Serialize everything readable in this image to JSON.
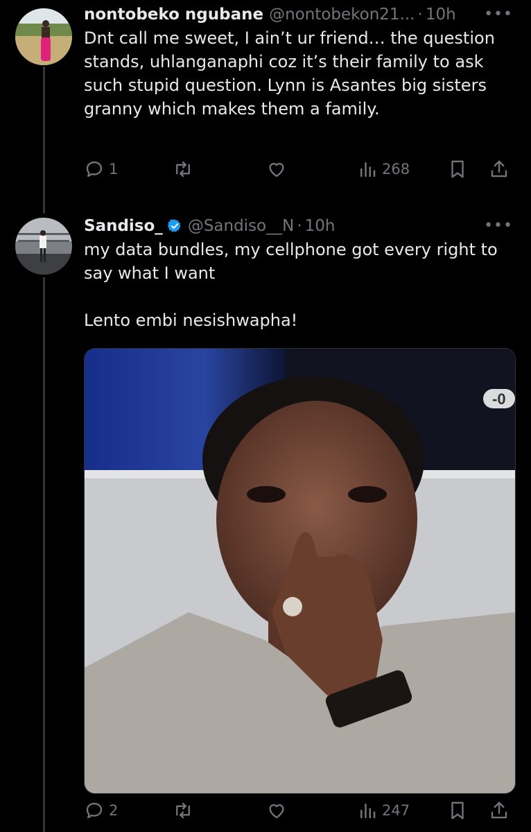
{
  "tweets": [
    {
      "display_name": "nontobeko ngubane",
      "handle": "@nontobekon21...",
      "separator": "·",
      "time": "10h",
      "verified": false,
      "text": "Dnt call me sweet, I ain’t ur friend… the question stands, uhlanganaphi coz it’s their family to ask such stupid question. Lynn is Asantes big sisters granny which makes them a family.",
      "replies": "1",
      "retweets": "",
      "likes": "",
      "views": "268"
    },
    {
      "display_name": "Sandiso_",
      "handle": "@Sandiso__N",
      "separator": "·",
      "time": "10h",
      "verified": true,
      "text": "my data bundles, my cellphone got every right to say what I want\n\nLento embi nesishwapha!",
      "media_overlay": "-0",
      "replies": "2",
      "retweets": "",
      "likes": "",
      "views": "247"
    }
  ],
  "colors": {
    "background": "#000000",
    "text": "#e7e9ea",
    "muted": "#71767b",
    "verified": "#1d9bf0",
    "thread_line": "#333639"
  },
  "icons": [
    "reply-icon",
    "retweet-icon",
    "like-icon",
    "views-icon",
    "bookmark-icon",
    "share-icon",
    "more-icon",
    "verified-badge-icon"
  ]
}
